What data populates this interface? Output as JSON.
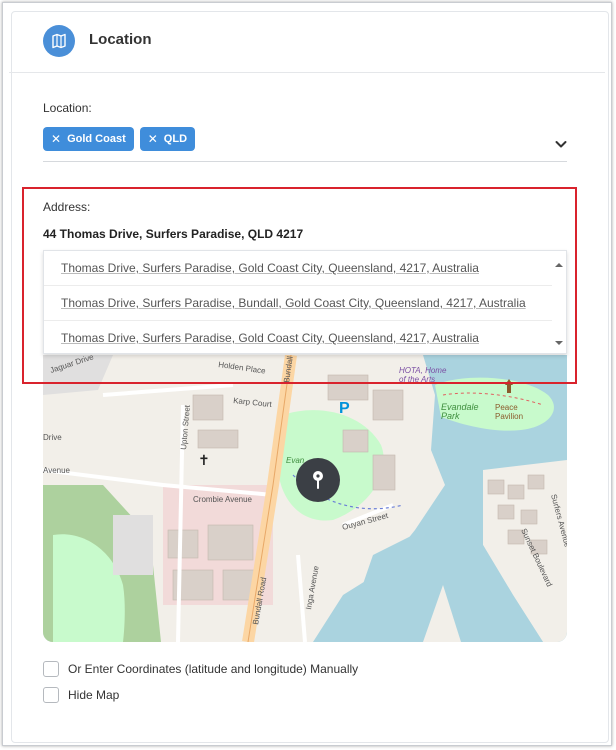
{
  "header": {
    "title": "Location",
    "icon": "map-icon",
    "icon_color": "#4a8fd8"
  },
  "location_field": {
    "label": "Location:",
    "chips": [
      {
        "label": "Gold Coast"
      },
      {
        "label": "QLD"
      }
    ],
    "chip_color": "#3f8ddb"
  },
  "address_field": {
    "label": "Address:",
    "value": "44 Thomas Drive, Surfers Paradise, QLD 4217",
    "suggestions": [
      "Thomas Drive, Surfers Paradise, Gold Coast City, Queensland, 4217, Australia",
      "Thomas Drive, Surfers Paradise, Bundall, Gold Coast City, Queensland, 4217, Australia",
      "Thomas Drive, Surfers Paradise, Gold Coast City, Queensland, 4217, Australia"
    ],
    "highlight_color": "#d9232d"
  },
  "map": {
    "labels": {
      "holden_place": "Holden Place",
      "jaguar_drive": "Jaguar Drive",
      "karp_court": "Karp Court",
      "upton_street": "Upton Street",
      "drive": "Drive",
      "avenue": "Avenue",
      "crombie_avenue": "Crombie Avenue",
      "bundall_road": "Bundall Road",
      "bundall": "Bundall",
      "inga_avenue": "Inga Avenue",
      "ouyan_street": "Ouyan Street",
      "evandale": "Evandale",
      "evandale_park": "Evandale\nPark",
      "evan": "Evan",
      "hota": "HOTA, Home\nof the Arts",
      "peace_pavilion": "Peace\nPavilion",
      "sunset_boulevard": "Sunset Boulevard",
      "surfers_avenue": "Surfers Avenue"
    },
    "water_color": "#aad3df",
    "pin_icon": "map-pin-icon"
  },
  "options": {
    "manual_coordinates": "Or Enter Coordinates (latitude and longitude) Manually",
    "hide_map": "Hide Map"
  }
}
